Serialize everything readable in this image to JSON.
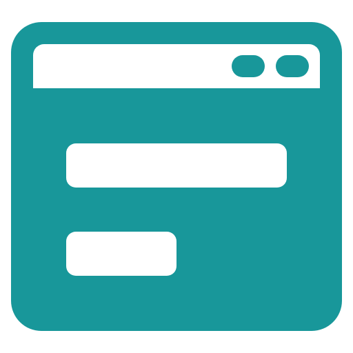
{
  "icon": {
    "name": "browser-window-form-icon",
    "colors": {
      "primary": "#18979A",
      "foreground": "#FFFFFF",
      "background": "#FFFFFF"
    },
    "parts": [
      "window-frame",
      "title-bar",
      "window-control-dot-1",
      "window-control-dot-2",
      "input-field-wide",
      "input-field-short"
    ]
  }
}
